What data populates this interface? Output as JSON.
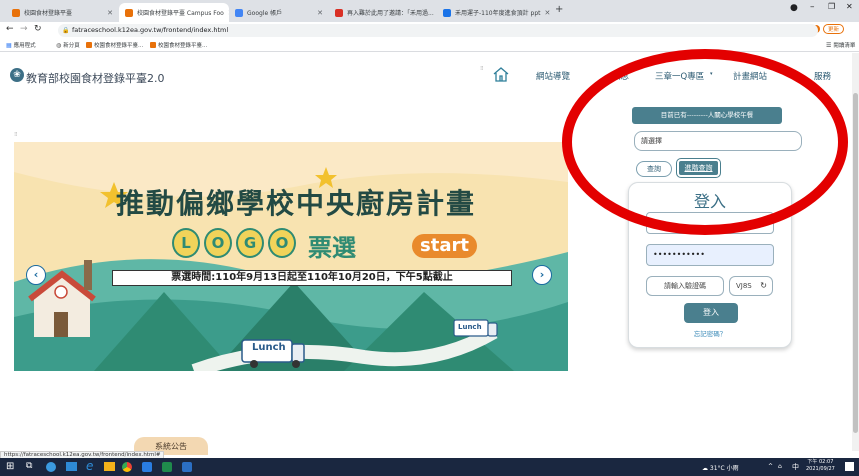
{
  "browser": {
    "tabs": [
      {
        "label": "校園食材登錄平臺",
        "color": "#e8710a",
        "active": false
      },
      {
        "label": "校園食材登錄平臺 Campus Foo",
        "color": "#e8710a",
        "active": true
      },
      {
        "label": "Google 帳戶",
        "color": "#4285f4",
        "active": false
      },
      {
        "label": "再入難於此用了邀請：「禾用過...",
        "color": "#d93025",
        "active": false
      },
      {
        "label": "禾用運子-110年度進食頂計 ppt",
        "color": "#1a73e8",
        "active": false
      }
    ],
    "new_tab": "+",
    "url": "fatraceschool.k12ea.gov.tw/frontend/index.html",
    "update_label": "更新",
    "bookmarks": [
      "應用程式",
      "新分頁",
      "校園食材登錄平臺...",
      "校園食材登錄平臺..."
    ],
    "reading_list": "閱讀清單",
    "status_url": "https://fatraceschool.k12ea.gov.tw/frontend/index.html#"
  },
  "site": {
    "title": "教育部校園食材登錄平臺2.0",
    "nav": [
      "網站導覽",
      "訊息",
      "三章一Q專區",
      "計畫網站",
      "服務"
    ]
  },
  "banner": {
    "headline": "推動偏鄉學校中央廚房計畫",
    "logo_letters": [
      "L",
      "O",
      "G",
      "O"
    ],
    "vote": "票選",
    "start": "start",
    "period": "票選時間:110年9月13日起至110年10月20日，下午5點截止",
    "lunch": "Lunch"
  },
  "panel": {
    "current_school": "目前已有---------人關心學校午餐",
    "select_placeholder": "請選擇",
    "query": "查詢",
    "advanced_query": "進階查詢",
    "login_title": "登入",
    "password_mask": "•••••••••••",
    "captcha_placeholder": "請輸入驗證碼",
    "captcha_code": "VJ8S",
    "login_button": "登入",
    "forgot": "忘記密碼？"
  },
  "announcement": "系統公告",
  "taskbar": {
    "weather": "31°C 小雨",
    "ime": "中",
    "time": "下午 02:07",
    "date": "2021/09/27"
  }
}
